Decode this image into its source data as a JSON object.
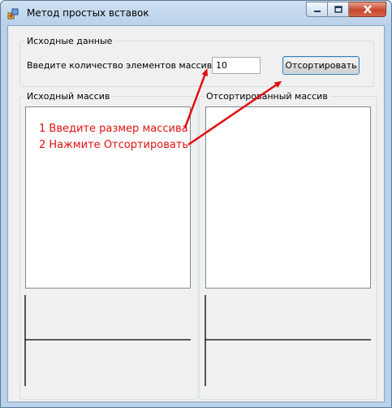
{
  "window": {
    "title": "Метод простых вставок"
  },
  "input_group": {
    "legend": "Исходные данные",
    "count_label": "Введите количество элементов массива:",
    "count_value": "10",
    "sort_button": "Отсортировать"
  },
  "source_group": {
    "legend": "Исходный массив"
  },
  "sorted_group": {
    "legend": "Отсортированный массив"
  },
  "annotations": {
    "step1": "1 Введите размер массива",
    "step2": "2 Нажмите Отсортировать",
    "color": "#e01010"
  }
}
